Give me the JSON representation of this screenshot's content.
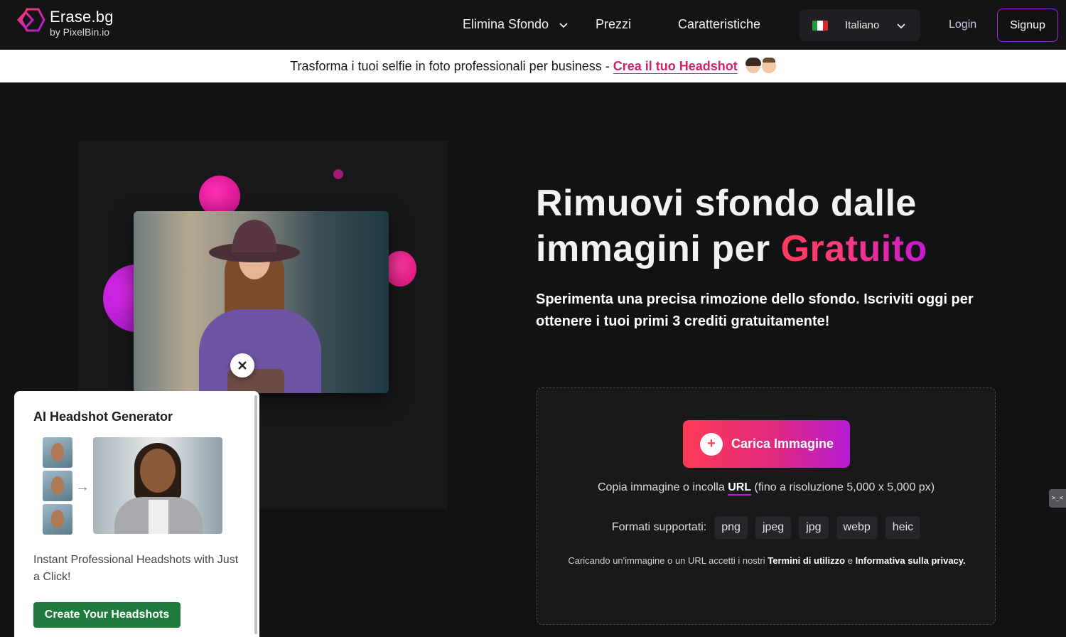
{
  "nav": {
    "logo_title": "Erase.bg",
    "logo_sub": "by PixelBin.io",
    "items": [
      {
        "label": "Elimina Sfondo"
      },
      {
        "label": "Prezzi"
      },
      {
        "label": "Caratteristiche"
      }
    ],
    "language": "Italiano",
    "login": "Login",
    "signup": "Signup"
  },
  "banner": {
    "text": "Trasforma i tuoi selfie in foto professionali per business -",
    "link": "Crea il tuo Headshot"
  },
  "hero": {
    "headline_line1": "Rimuovi sfondo dalle",
    "headline_line2_prefix": "immagini per",
    "headline_highlight": "Gratuito",
    "subtitle": "Sperimenta una precisa rimozione dello sfondo. Iscriviti oggi per ottenere i tuoi primi 3 crediti gratuitamente!"
  },
  "upload": {
    "button": "Carica Immagine",
    "paste_prefix": "Copia immagine o incolla",
    "paste_url": "URL",
    "paste_suffix": "(fino a risoluzione 5,000 x 5,000 px)",
    "formats_label": "Formati supportati:",
    "formats": [
      "png",
      "jpeg",
      "jpg",
      "webp",
      "heic"
    ],
    "terms_prefix": "Caricando un'immagine o un URL accetti i nostri",
    "terms_link": "Termini di utilizzo",
    "terms_and": "e",
    "privacy_link": "Informativa sulla privacy."
  },
  "popup": {
    "title": "AI Headshot Generator",
    "description": "Instant Professional Headshots with Just a Click!",
    "button": "Create Your Headshots"
  },
  "colors": {
    "accent_gradient_start": "#ff3b56",
    "accent_gradient_end": "#b71dd6",
    "banner_link": "#d6216b",
    "popup_button": "#1e7a3d"
  }
}
